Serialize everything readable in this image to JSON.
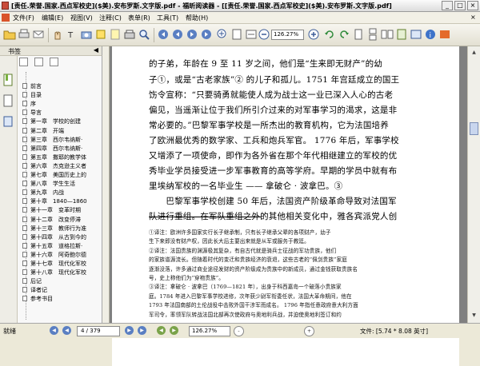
{
  "window": {
    "title": "[责任.荣誉.国家.西点军校史]($美).安布罗斯.文字版.pdf - 福昕阅读器 - [[责任.荣誉.国家.西点军校史]($美).安布罗斯.文字版.pdf]",
    "minimize": "_",
    "maximize": "□",
    "close": "×"
  },
  "menu": {
    "items": [
      "文件(F)",
      "编辑(E)",
      "视图(V)",
      "注释(C)",
      "表单(R)",
      "工具(T)",
      "帮助(H)"
    ],
    "doc_close": "×"
  },
  "toolbar": {
    "zoom_value": "126.27%"
  },
  "sidebar": {
    "title": "书签",
    "collapse": "◀",
    "bookmarks": [
      "前言",
      "目录",
      "序",
      "导言",
      "第一章　学校的创建",
      "第二章　开端",
      "第三章　西尔韦纳斯·",
      "第四章　西尔韦纳斯·",
      "第五章　撒耶的教学体",
      "第六章　杰克逊主义者",
      "第七章　美国历史上的",
      "第八章　学生生活",
      "第九章　内战",
      "第十章　1840—1860",
      "第十一章　变革时期",
      "第十二章　改变停滞",
      "第十三章　教师行为准",
      "第十四章　从古到今的",
      "第十五章　道格拉斯·",
      "第十六章　阿奇鲍尔德",
      "第十七章　现代化军校",
      "第十八章　现代化军校",
      "后记",
      "译者记",
      "参考书目"
    ]
  },
  "document": {
    "body_lines": [
      "的子弟，年龄在 9 至 11 岁之间，他们是“生来即无财产”的幼",
      "子①，或是“古老家族”② 的儿子和孤儿。1751 年宫廷成立的国王",
      "饬令宣称：“只要骑勇就能使人成为战士这一业已深入人心的古老",
      "偏见，当遥渐让位于我们所引介过来的对军事学习的渴求，这是非",
      "常必要的。”巴黎军事学校是一所杰出的教育机构，它为法国培养",
      "了欧洲最优秀的数学家、工兵和炮兵军官。 1776 年后，军事学校",
      "又增添了一项使命，即作为各外省在那个年代相继建立的军校的优",
      "秀毕业学员接受进一步军事教育的高等学府。早期的学员中就有布",
      "里埃纳军校的一名毕业生 —— 拿破仑 · 波拿巴。③",
      "　　巴黎军事学校创建 50 年后，法国资产阶级革命导致对法国军",
      "队进行重组。在军队重组之外的其他相关变化中，雅各宾派党人创"
    ],
    "notes": [
      "①译注：欧洲许多国家实行长子继承制，只有长子继承父辈的各项财产，幼子",
      "生下来即没有财产权，因此长大后主要出来就是从军或服务于教廷。",
      "②译注：法国贵族的渊源极其复杂，有自古代就是骑兵士征战的军功贵族，他们",
      "的家族谱源流长。但随着时代的变迁和贵族经济的衰退，这些古老的“佩剑贵族”家庭",
      "逐渐没落，许多通过商业途径发财的资产阶级成为贵族中的新成员，通过金钱获取贵族名",
      "号，史上称他们为“穿袍贵族”。",
      "③译注：拿破仑 · 波拿巴（1769—1821 年），出身于科西嘉岛一个破落小贵族家",
      "庭。1784 年进入巴黎军事学校进修，次年获少尉军衔委任状，法国大革命期间，他在",
      "1793 年法国南部的土伦战役中击败外国干涉军而成名。 1796 年指任意政府意大利方面",
      "军司令，率领军队转战法国北部再次使政府与奥地利兵战，并迫使奥地利签订和约"
    ]
  },
  "status": {
    "ready": "就绪",
    "page_display": "4 / 379",
    "zoom": "126.27%",
    "doc_info": "文件: [5.74 * 8.08 英寸]"
  },
  "colors": {
    "chrome": "#ece9d8",
    "page_background": "#808080",
    "accent_blue": "#5a7fc2"
  }
}
